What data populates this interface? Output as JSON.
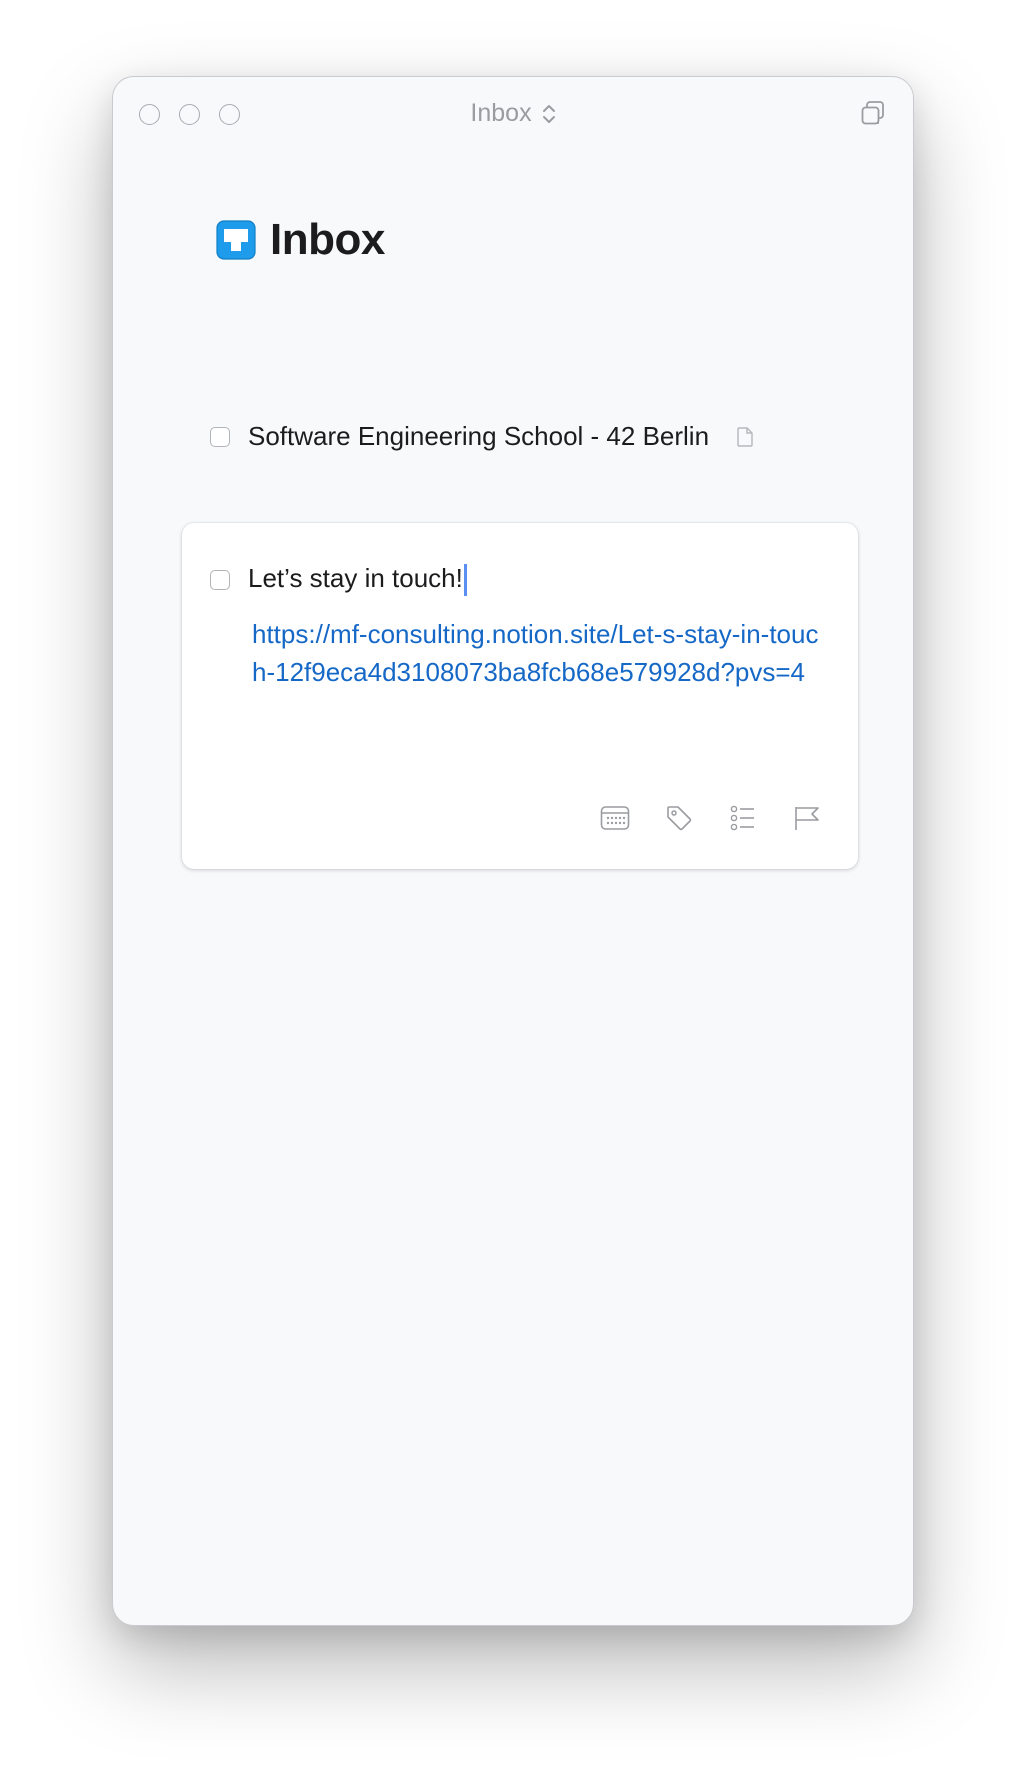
{
  "window": {
    "title": "Inbox"
  },
  "page": {
    "heading": "Inbox",
    "heading_icon": "inbox-tray-icon",
    "accent_color": "#1E9BEA"
  },
  "tasks": [
    {
      "title": "Software Engineering School - 42 Berlin",
      "has_notes": true,
      "completed": false
    }
  ],
  "editing_task": {
    "title": "Let’s stay in touch!",
    "notes": "https://mf-consulting.notion.site/Let-s-stay-in-touch-12f9eca4d3108073ba8fcb68e579928d?pvs=4",
    "completed": false,
    "actions": [
      "calendar-icon",
      "tag-icon",
      "checklist-icon",
      "flag-icon"
    ]
  },
  "colors": {
    "link": "#1668C7",
    "caret": "#5B8FF0"
  }
}
